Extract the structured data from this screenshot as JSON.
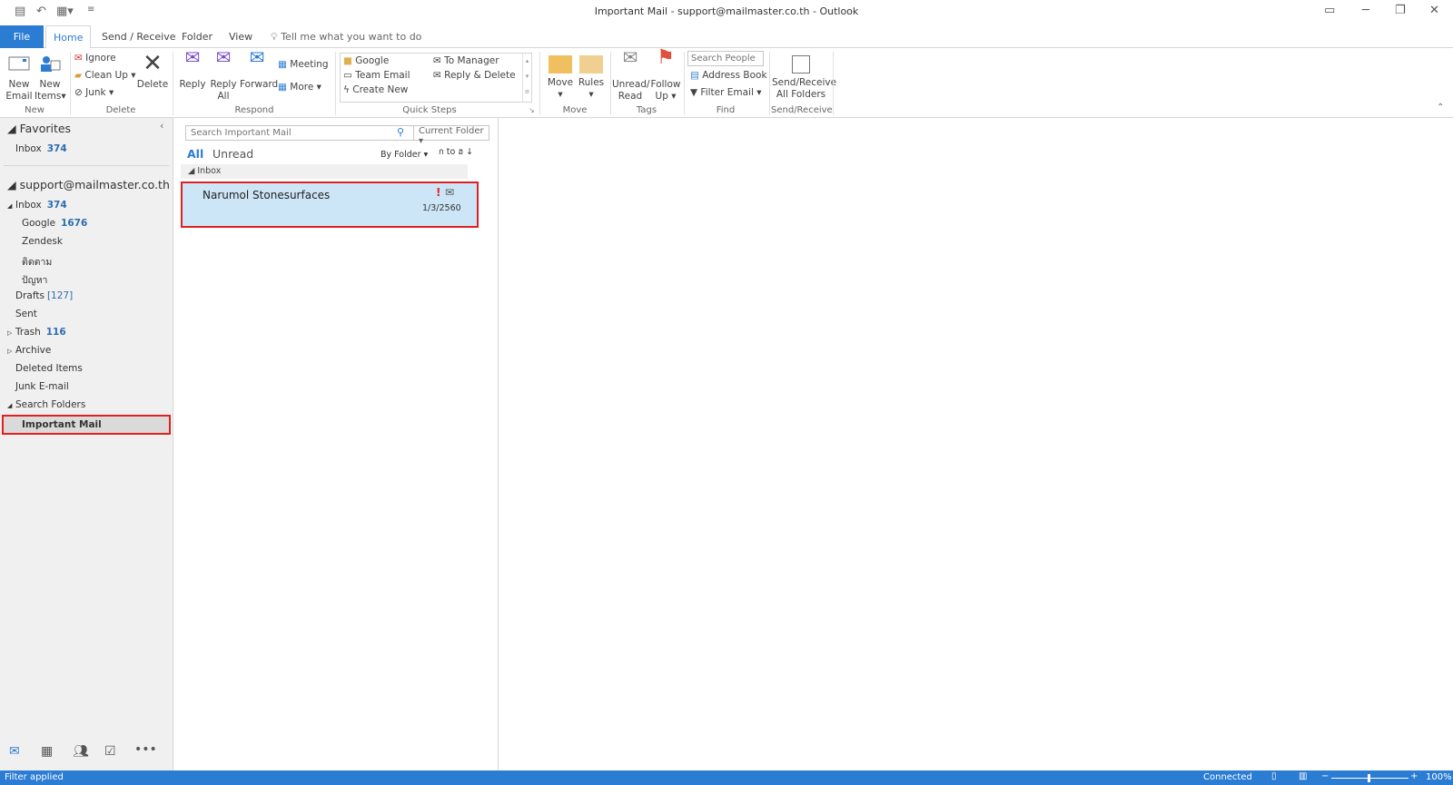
{
  "window": {
    "title": "Important Mail - support@mailmaster.co.th  -  Outlook"
  },
  "tabs": [
    "File",
    "Home",
    "Send / Receive",
    "Folder",
    "View"
  ],
  "tell_me": "Tell me what you want to do",
  "ribbon": {
    "new": {
      "new_email": "New Email",
      "new_items": "New Items",
      "group": "New"
    },
    "delete": {
      "ignore": "Ignore",
      "clean_up": "Clean Up",
      "junk": "Junk",
      "delete": "Delete",
      "group": "Delete"
    },
    "respond": {
      "reply": "Reply",
      "reply_all": "Reply All",
      "forward": "Forward",
      "meeting": "Meeting",
      "more": "More",
      "group": "Respond"
    },
    "quick_steps": {
      "items": [
        "Google",
        "Team Email",
        "Create New",
        "To Manager",
        "Reply & Delete"
      ],
      "group": "Quick Steps"
    },
    "move": {
      "move": "Move",
      "rules": "Rules",
      "group": "Move"
    },
    "tags": {
      "unread_read": "Unread/ Read",
      "follow_up": "Follow Up",
      "group": "Tags"
    },
    "find": {
      "search_people_placeholder": "Search People",
      "address_book": "Address Book",
      "filter_email": "Filter Email",
      "group": "Find"
    },
    "send_receive": {
      "all_folders": "Send/Receive All Folders",
      "group": "Send/Receive"
    }
  },
  "folders": {
    "favorites_label": "Favorites",
    "favorites": [
      {
        "name": "Inbox",
        "count": "374"
      }
    ],
    "account": "support@mailmaster.co.th",
    "items": [
      {
        "name": "Inbox",
        "count": "374",
        "level": 0,
        "expander": "open"
      },
      {
        "name": "Google",
        "count": "1676",
        "level": 1
      },
      {
        "name": "Zendesk",
        "count": "",
        "level": 1
      },
      {
        "name": "ติดตาม",
        "count": "",
        "level": 1
      },
      {
        "name": "ปัญหา",
        "count": "",
        "level": 1
      },
      {
        "name": "Drafts",
        "count": "[127]",
        "level": 0
      },
      {
        "name": "Sent",
        "count": "",
        "level": 0
      },
      {
        "name": "Trash",
        "count": "116",
        "level": 0,
        "expander": "closed"
      },
      {
        "name": "Archive",
        "count": "",
        "level": 0,
        "expander": "closed"
      },
      {
        "name": "Deleted Items",
        "count": "",
        "level": 0
      },
      {
        "name": "Junk E-mail",
        "count": "",
        "level": 0
      },
      {
        "name": "Search Folders",
        "count": "",
        "level": 0,
        "expander": "open"
      },
      {
        "name": "Important Mail",
        "count": "",
        "level": 1,
        "selected": true
      }
    ]
  },
  "list": {
    "search_placeholder": "Search Important Mail",
    "scope": "Current Folder",
    "filter_all": "All",
    "filter_unread": "Unread",
    "arrange": "By Folder",
    "sort": "ก to ฮ",
    "group_header": "Inbox",
    "messages": [
      {
        "sender": "Narumol Stonesurfaces",
        "date": "1/3/2560",
        "importance": "high"
      }
    ]
  },
  "status": {
    "left": "Filter applied",
    "connection": "Connected",
    "zoom": "100%"
  },
  "colors": {
    "accent": "#2b7cd3",
    "highlight_border": "#e02020",
    "selected_row": "#cde6f7"
  }
}
